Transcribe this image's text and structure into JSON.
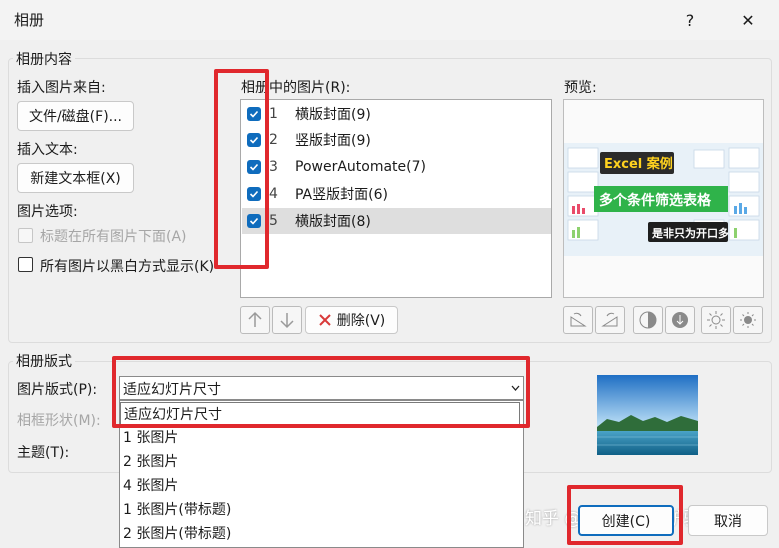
{
  "window": {
    "title": "相册",
    "help": "?",
    "close": "✕"
  },
  "content_group": {
    "legend": "相册内容"
  },
  "insert_picture": {
    "label": "插入图片来自:",
    "file_button": "文件/磁盘(F)..."
  },
  "insert_text": {
    "label": "插入文本:",
    "new_textbox_button": "新建文本框(X)"
  },
  "picture_options": {
    "label": "图片选项:",
    "captions_below": "标题在所有图片下面(A)",
    "black_white": "所有图片以黑白方式显示(K)"
  },
  "pictures_list": {
    "label": "相册中的图片(R):",
    "items": [
      {
        "num": "1",
        "name": "横版封面(9)",
        "checked": true
      },
      {
        "num": "2",
        "name": "竖版封面(9)",
        "checked": true
      },
      {
        "num": "3",
        "name": "PowerAutomate(7)",
        "checked": true
      },
      {
        "num": "4",
        "name": "PA竖版封面(6)",
        "checked": true
      },
      {
        "num": "5",
        "name": "横版封面(8)",
        "checked": true,
        "selected": true
      }
    ],
    "delete_button": "删除(V)"
  },
  "preview": {
    "label": "预览:",
    "image_text": {
      "line1": "Excel 案例",
      "line2": "多个条件筛选表格",
      "line3": "是非只为开口多"
    }
  },
  "layout_group": {
    "legend": "相册版式",
    "picture_layout_label": "图片版式(P):",
    "picture_layout_value": "适应幻灯片尺寸",
    "frame_shape_label": "相框形状(M):",
    "theme_label": "主题(T):",
    "dropdown_options": [
      "适应幻灯片尺寸",
      "1 张图片",
      "2 张图片",
      "4 张图片",
      "1 张图片(带标题)",
      "2 张图片(带标题)"
    ]
  },
  "footer": {
    "create_button": "创建(C)",
    "cancel_button": "取消",
    "watermark": "知乎 @我有一头小驴驴"
  },
  "colors": {
    "accent": "#0f6cbd",
    "highlight": "#e0282d"
  }
}
